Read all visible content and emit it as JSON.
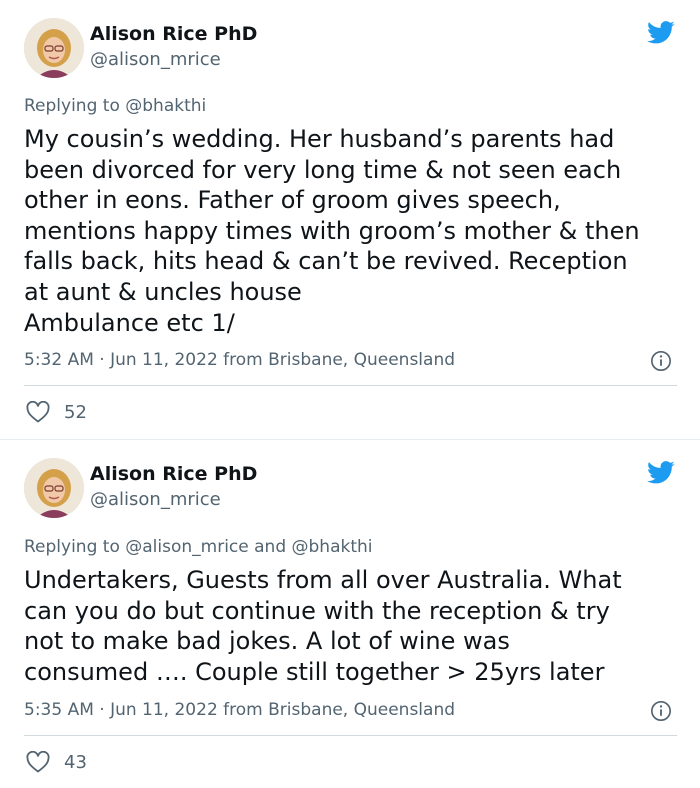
{
  "tweets": [
    {
      "name": "Alison Rice PhD",
      "handle": "@alison_mrice",
      "replying_prefix": "Replying to",
      "replying_to": "@bhakthi",
      "text": "My cousin’s wedding. Her husband’s parents had\nbeen divorced for very long time & not seen each\nother in eons. Father of groom gives speech,\nmentions happy times with groom’s mother & then\nfalls back, hits head & can’t be revived. Reception\nat aunt & uncles house\nAmbulance etc 1/",
      "meta": "5:32 AM · Jun 11, 2022 from Brisbane, Queensland",
      "likes": "52"
    },
    {
      "name": "Alison Rice PhD",
      "handle": "@alison_mrice",
      "replying_prefix": "Replying to",
      "replying_to": "@alison_mrice and @bhakthi",
      "text": "Undertakers, Guests from all over Australia. What\ncan you do but continue with the reception & try\nnot to make bad jokes. A lot of wine was\nconsumed …. Couple still together > 25yrs later",
      "meta": "5:35 AM · Jun 11, 2022 from Brisbane, Queensland",
      "likes": "43"
    }
  ],
  "colors": {
    "twitter_blue": "#1d9bf0",
    "text_primary": "#0f1419",
    "text_secondary": "#536471",
    "divider": "#cfd9de"
  },
  "icons": {
    "logo": "twitter-bird-icon",
    "info": "info-icon",
    "like": "heart-icon"
  }
}
